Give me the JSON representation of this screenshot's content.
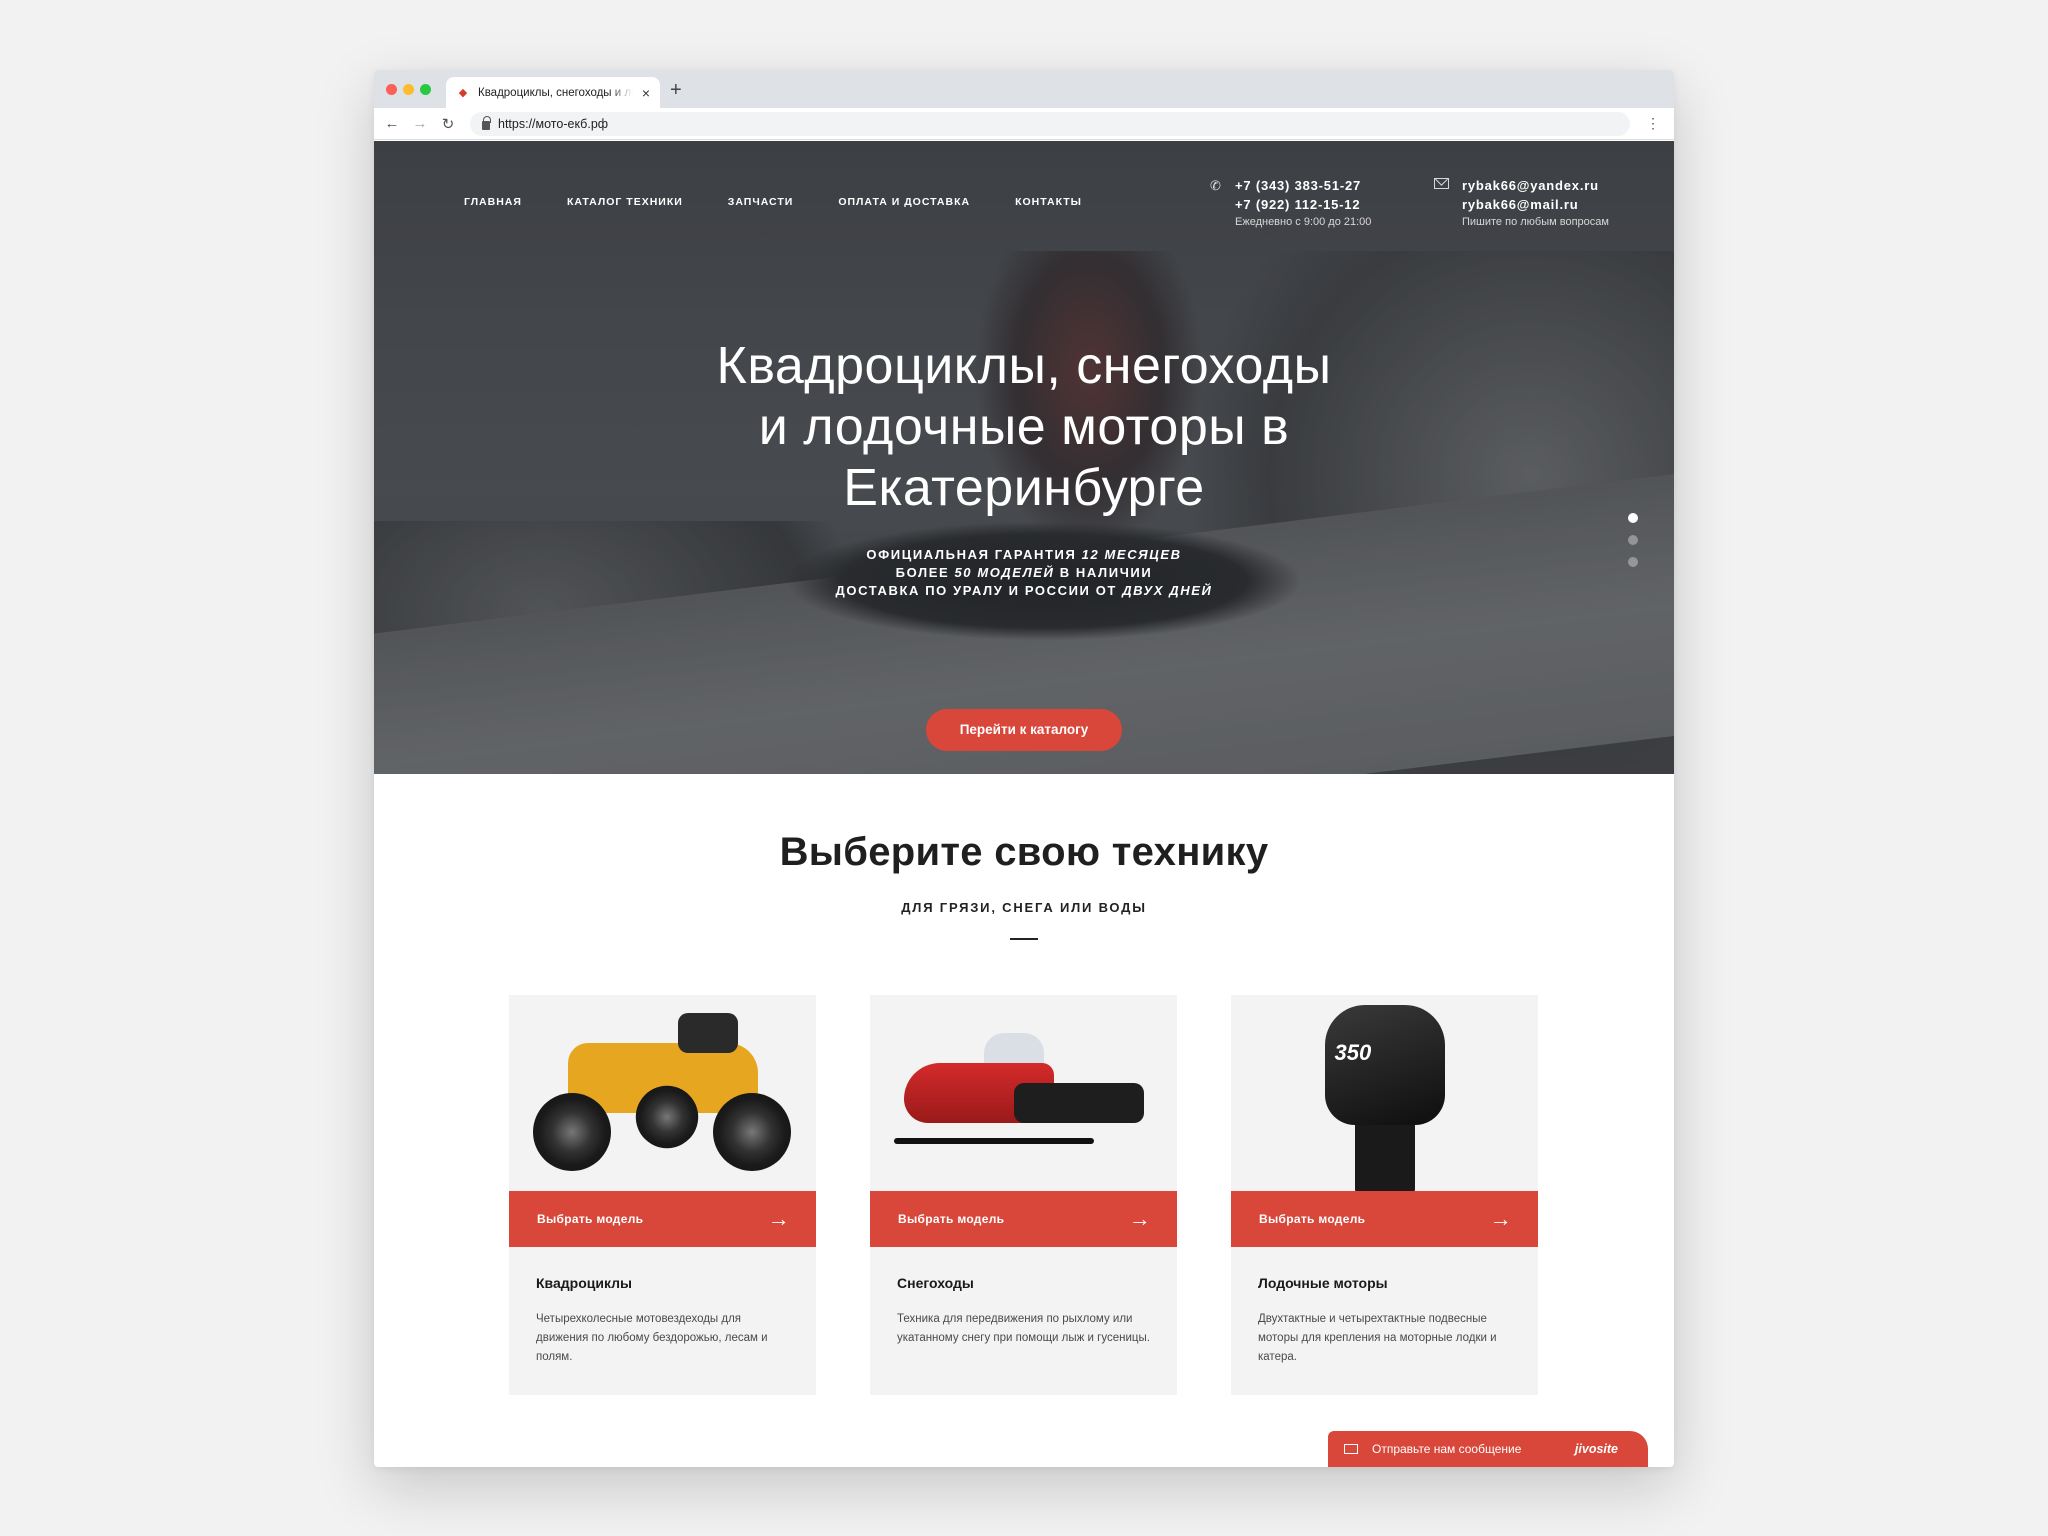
{
  "browser": {
    "tab_title": "Квадроциклы, снегоходы и лодочные моторы",
    "url": "https://мото-екб.рф",
    "new_tab_label": "+",
    "close_label": "×"
  },
  "nav": {
    "items": [
      "ГЛАВНАЯ",
      "КАТАЛОГ ТЕХНИКИ",
      "ЗАПЧАСТИ",
      "ОПЛАТА И ДОСТАВКА",
      "КОНТАКТЫ"
    ]
  },
  "contacts": {
    "phone1": "+7 (343) 383-51-27",
    "phone2": "+7 (922) 112-15-12",
    "hours": "Ежедневно с 9:00 до 21:00",
    "email1": "rybak66@yandex.ru",
    "email2": "rybak66@mail.ru",
    "email_note": "Пишите по любым вопросам"
  },
  "hero": {
    "title_line1": "Квадроциклы, снегоходы",
    "title_line2": "и лодочные моторы в",
    "title_line3": "Екатеринбурге",
    "line1_a": "ОФИЦИАЛЬНАЯ ГАРАНТИЯ ",
    "line1_b": "12 МЕСЯЦЕВ",
    "line2_a": "БОЛЕЕ ",
    "line2_b": "50 МОДЕЛЕЙ",
    "line2_c": " В НАЛИЧИИ",
    "line3_a": "ДОСТАВКА ПО УРАЛУ И РОССИИ ОТ ",
    "line3_b": "ДВУХ ДНЕЙ",
    "cta": "Перейти к каталогу",
    "slide_count": 3,
    "active_slide": 1
  },
  "section": {
    "title": "Выберите свою технику",
    "subtitle": "ДЛЯ ГРЯЗИ, СНЕГА ИЛИ ВОДЫ"
  },
  "cards": [
    {
      "button": "Выбрать модель",
      "title": "Квадроциклы",
      "text": "Четырехколесные мотовездеходы для движения по любому бездорожью, лесам и полям."
    },
    {
      "button": "Выбрать модель",
      "title": "Снегоходы",
      "text": "Техника для передвижения по рыхлому или укатанному снегу при помощи лыж и гусеницы."
    },
    {
      "button": "Выбрать модель",
      "title": "Лодочные моторы",
      "text": "Двухтактные и четырехтактные подвесные моторы для крепления на моторные лодки и катера.",
      "image_label": "350"
    }
  ],
  "chat": {
    "text": "Отправьте нам сообщение",
    "brand": "jivosite"
  },
  "colors": {
    "accent": "#d9463a",
    "hero_dark": "#4a4d52",
    "card_bg": "#f3f3f3"
  },
  "icons": {
    "arrow": "→",
    "back": "←",
    "forward": "→",
    "reload": "↻",
    "menu": "⋮",
    "phone": "✆"
  }
}
